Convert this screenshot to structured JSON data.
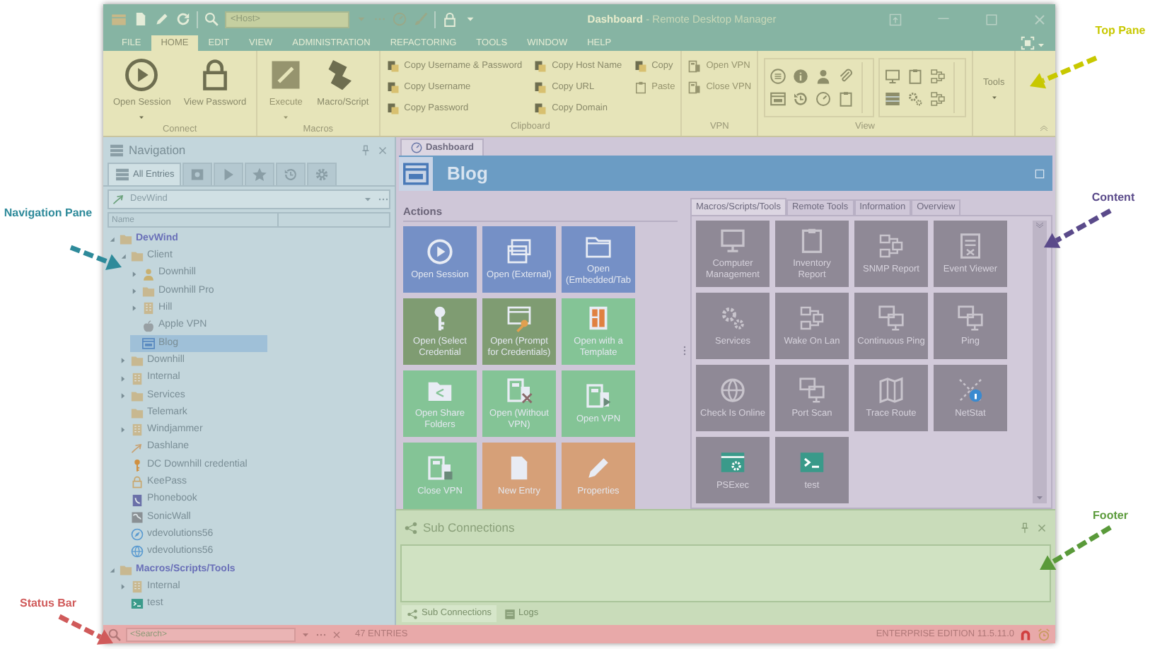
{
  "annotations": [
    {
      "label": "Top Pane",
      "color": "#c8c800"
    },
    {
      "label": "Navigation Pane",
      "color": "#2e8a9a"
    },
    {
      "label": "Content",
      "color": "#5a4a8a"
    },
    {
      "label": "Footer",
      "color": "#5a9a3a"
    },
    {
      "label": "Status Bar",
      "color": "#d05a5a"
    }
  ],
  "window": {
    "title": "**Dashboard** - Remote Desktop Manager"
  },
  "quick_access": {
    "host_placeholder": "<Host>"
  },
  "menu": [
    {
      "label": "FILE",
      "selected": false
    },
    {
      "label": "HOME",
      "selected": true
    },
    {
      "label": "EDIT",
      "selected": false
    },
    {
      "label": "VIEW",
      "selected": false
    },
    {
      "label": "ADMINISTRATION",
      "selected": false
    },
    {
      "label": "REFACTORING",
      "selected": false
    },
    {
      "label": "TOOLS",
      "selected": false
    },
    {
      "label": "WINDOW",
      "selected": false
    },
    {
      "label": "HELP",
      "selected": false
    }
  ],
  "ribbon": [
    {
      "label": "Connect",
      "kind": "buttons",
      "large_buttons": [
        {
          "label": "Open Session",
          "kind": "play",
          "dropdown": true,
          "disabled": false
        },
        {
          "label": "View Password",
          "kind": "lock",
          "dropdown": false,
          "disabled": false
        }
      ]
    },
    {
      "label": "Macros",
      "kind": "buttons",
      "large_buttons": [
        {
          "label": "Execute",
          "kind": "execute",
          "dropdown": true,
          "disabled": true
        },
        {
          "label": "Macro/Script",
          "kind": "script",
          "dropdown": false,
          "disabled": false
        }
      ]
    },
    {
      "label": "Clipboard",
      "kind": "buttons",
      "small_buttons": [
        {
          "label": "Copy Username & Password",
          "kind": "copy",
          "disabled": false
        },
        {
          "label": "Copy Username",
          "kind": "copy",
          "disabled": false
        },
        {
          "label": "Copy Password",
          "kind": "copy",
          "disabled": false
        },
        {
          "label": "Copy Host Name",
          "kind": "copy",
          "disabled": false
        },
        {
          "label": "Copy URL",
          "kind": "copy",
          "disabled": false
        },
        {
          "label": "Copy Domain",
          "kind": "copy",
          "disabled": false
        },
        {
          "label": "Copy",
          "kind": "copy",
          "disabled": false
        },
        {
          "label": "Paste",
          "kind": "paste",
          "disabled": true
        }
      ]
    },
    {
      "label": "VPN",
      "kind": "buttons",
      "small_buttons": [
        {
          "label": "Open VPN",
          "kind": "vpn",
          "disabled": true
        },
        {
          "label": "Close VPN",
          "kind": "vpn",
          "disabled": true
        }
      ]
    },
    {
      "label": "View",
      "kind": "gallery"
    },
    {
      "kind": "buttons",
      "large_buttons": [
        {
          "label": "Tools",
          "kind": "none",
          "dropdown": true,
          "disabled": false
        }
      ]
    }
  ],
  "navigation": {
    "title": "Navigation",
    "tabs": [
      {
        "label": "All Entries",
        "kind": "vault",
        "selected": true
      },
      {
        "kind": "safe",
        "selected": false
      },
      {
        "kind": "play",
        "selected": false
      },
      {
        "kind": "star",
        "selected": false
      },
      {
        "kind": "history",
        "selected": false
      },
      {
        "kind": "gear",
        "selected": false
      }
    ],
    "datasource": "DevWind",
    "columns": [
      "Name"
    ],
    "tree": [
      {
        "label": "DevWind",
        "kind": "folder",
        "expanded": true,
        "selected": false,
        "children": [
          {
            "label": "Client",
            "kind": "folder",
            "expanded": true,
            "selected": false,
            "children": [
              {
                "label": "Downhill",
                "kind": "person",
                "expanded": false,
                "selected": false
              },
              {
                "label": "Downhill Pro",
                "kind": "folder",
                "expanded": false,
                "selected": false
              },
              {
                "label": "Hill",
                "kind": "building",
                "expanded": false,
                "selected": false
              },
              {
                "label": "Apple VPN",
                "kind": "apple",
                "selected": false
              },
              {
                "label": "Blog",
                "kind": "web",
                "selected": true
              }
            ]
          },
          {
            "label": "Downhill",
            "kind": "folder",
            "expanded": false,
            "selected": false
          },
          {
            "label": "Internal",
            "kind": "building",
            "expanded": false,
            "selected": false
          },
          {
            "label": "Services",
            "kind": "folder",
            "expanded": false,
            "selected": false
          },
          {
            "label": "Telemark",
            "kind": "folder",
            "selected": false
          },
          {
            "label": "Windjammer",
            "kind": "building",
            "expanded": false,
            "selected": false
          },
          {
            "label": "Dashlane",
            "kind": "dashlane",
            "selected": false
          },
          {
            "label": "DC Downhill credential",
            "kind": "key",
            "selected": false
          },
          {
            "label": "KeePass",
            "kind": "lock",
            "selected": false
          },
          {
            "label": "Phonebook",
            "kind": "phone",
            "selected": false
          },
          {
            "label": "SonicWall",
            "kind": "wall",
            "selected": false
          },
          {
            "label": "vdevolutions56",
            "kind": "compass",
            "selected": false
          },
          {
            "label": "vdevolutions56",
            "kind": "globe",
            "selected": false
          }
        ]
      },
      {
        "label": "Macros/Scripts/Tools",
        "kind": "folder",
        "expanded": true,
        "selected": false,
        "children": [
          {
            "label": "Internal",
            "kind": "building",
            "expanded": false,
            "selected": false
          },
          {
            "label": "test",
            "kind": "terminal",
            "selected": false
          }
        ]
      }
    ]
  },
  "document_tabs": [
    {
      "label": "Dashboard",
      "selected": true
    }
  ],
  "entry": {
    "title": "Blog"
  },
  "actions": {
    "title": "Actions",
    "tiles": [
      {
        "label": "Open Session",
        "kind": "play",
        "color": "#7590c6"
      },
      {
        "label": "Open (External)",
        "kind": "windows",
        "color": "#7590c6"
      },
      {
        "label": "Open (Embedded/Tab",
        "kind": "folder",
        "color": "#7590c6"
      },
      {
        "label": "Open (Select Credential",
        "kind": "key",
        "color": "#7f9c72"
      },
      {
        "label": "Open (Prompt for Credentials)",
        "kind": "winkey",
        "color": "#7f9c72"
      },
      {
        "label": "Open with a Template",
        "kind": "template",
        "color": "#84c496"
      },
      {
        "label": "Open Share Folders",
        "kind": "share",
        "color": "#84c496"
      },
      {
        "label": "Open (Without VPN)",
        "kind": "vpnx",
        "color": "#84c496"
      },
      {
        "label": "Open VPN",
        "kind": "vpnplay",
        "color": "#84c496"
      },
      {
        "label": "Close VPN",
        "kind": "vpnstop",
        "color": "#84c496"
      },
      {
        "label": "New Entry",
        "kind": "page",
        "color": "#d6a078"
      },
      {
        "label": "Properties",
        "kind": "pencil",
        "color": "#d6a078"
      }
    ]
  },
  "tools": {
    "tabs": [
      {
        "label": "Macros/Scripts/Tools",
        "selected": true
      },
      {
        "label": "Remote Tools",
        "selected": false
      },
      {
        "label": "Information",
        "selected": false
      },
      {
        "label": "Overview",
        "selected": false
      }
    ],
    "tiles": [
      {
        "label": "Computer Management",
        "kind": "monitor"
      },
      {
        "label": "Inventory Report",
        "kind": "clipboard"
      },
      {
        "label": "SNMP Report",
        "kind": "network"
      },
      {
        "label": "Event Viewer",
        "kind": "list"
      },
      {
        "label": "Services",
        "kind": "gears"
      },
      {
        "label": "Wake On Lan",
        "kind": "network"
      },
      {
        "label": "Continuous Ping",
        "kind": "monitors"
      },
      {
        "label": "Ping",
        "kind": "monitors"
      },
      {
        "label": "Check Is Online",
        "kind": "globe"
      },
      {
        "label": "Port Scan",
        "kind": "monitors"
      },
      {
        "label": "Trace Route",
        "kind": "map"
      },
      {
        "label": "NetStat",
        "kind": "netstat"
      },
      {
        "label": "PSExec",
        "kind": "wingear"
      },
      {
        "label": "test",
        "kind": "terminal"
      }
    ]
  },
  "footer": {
    "title": "Sub Connections",
    "tabs": [
      {
        "label": "Sub Connections",
        "kind": "tree",
        "selected": true
      },
      {
        "label": "Logs",
        "kind": "log",
        "selected": false
      }
    ]
  },
  "status_bar": {
    "search_placeholder": "<Search>",
    "entries": "47 ENTRIES",
    "edition": "ENTERPRISE EDITION 11.5.11.0"
  }
}
